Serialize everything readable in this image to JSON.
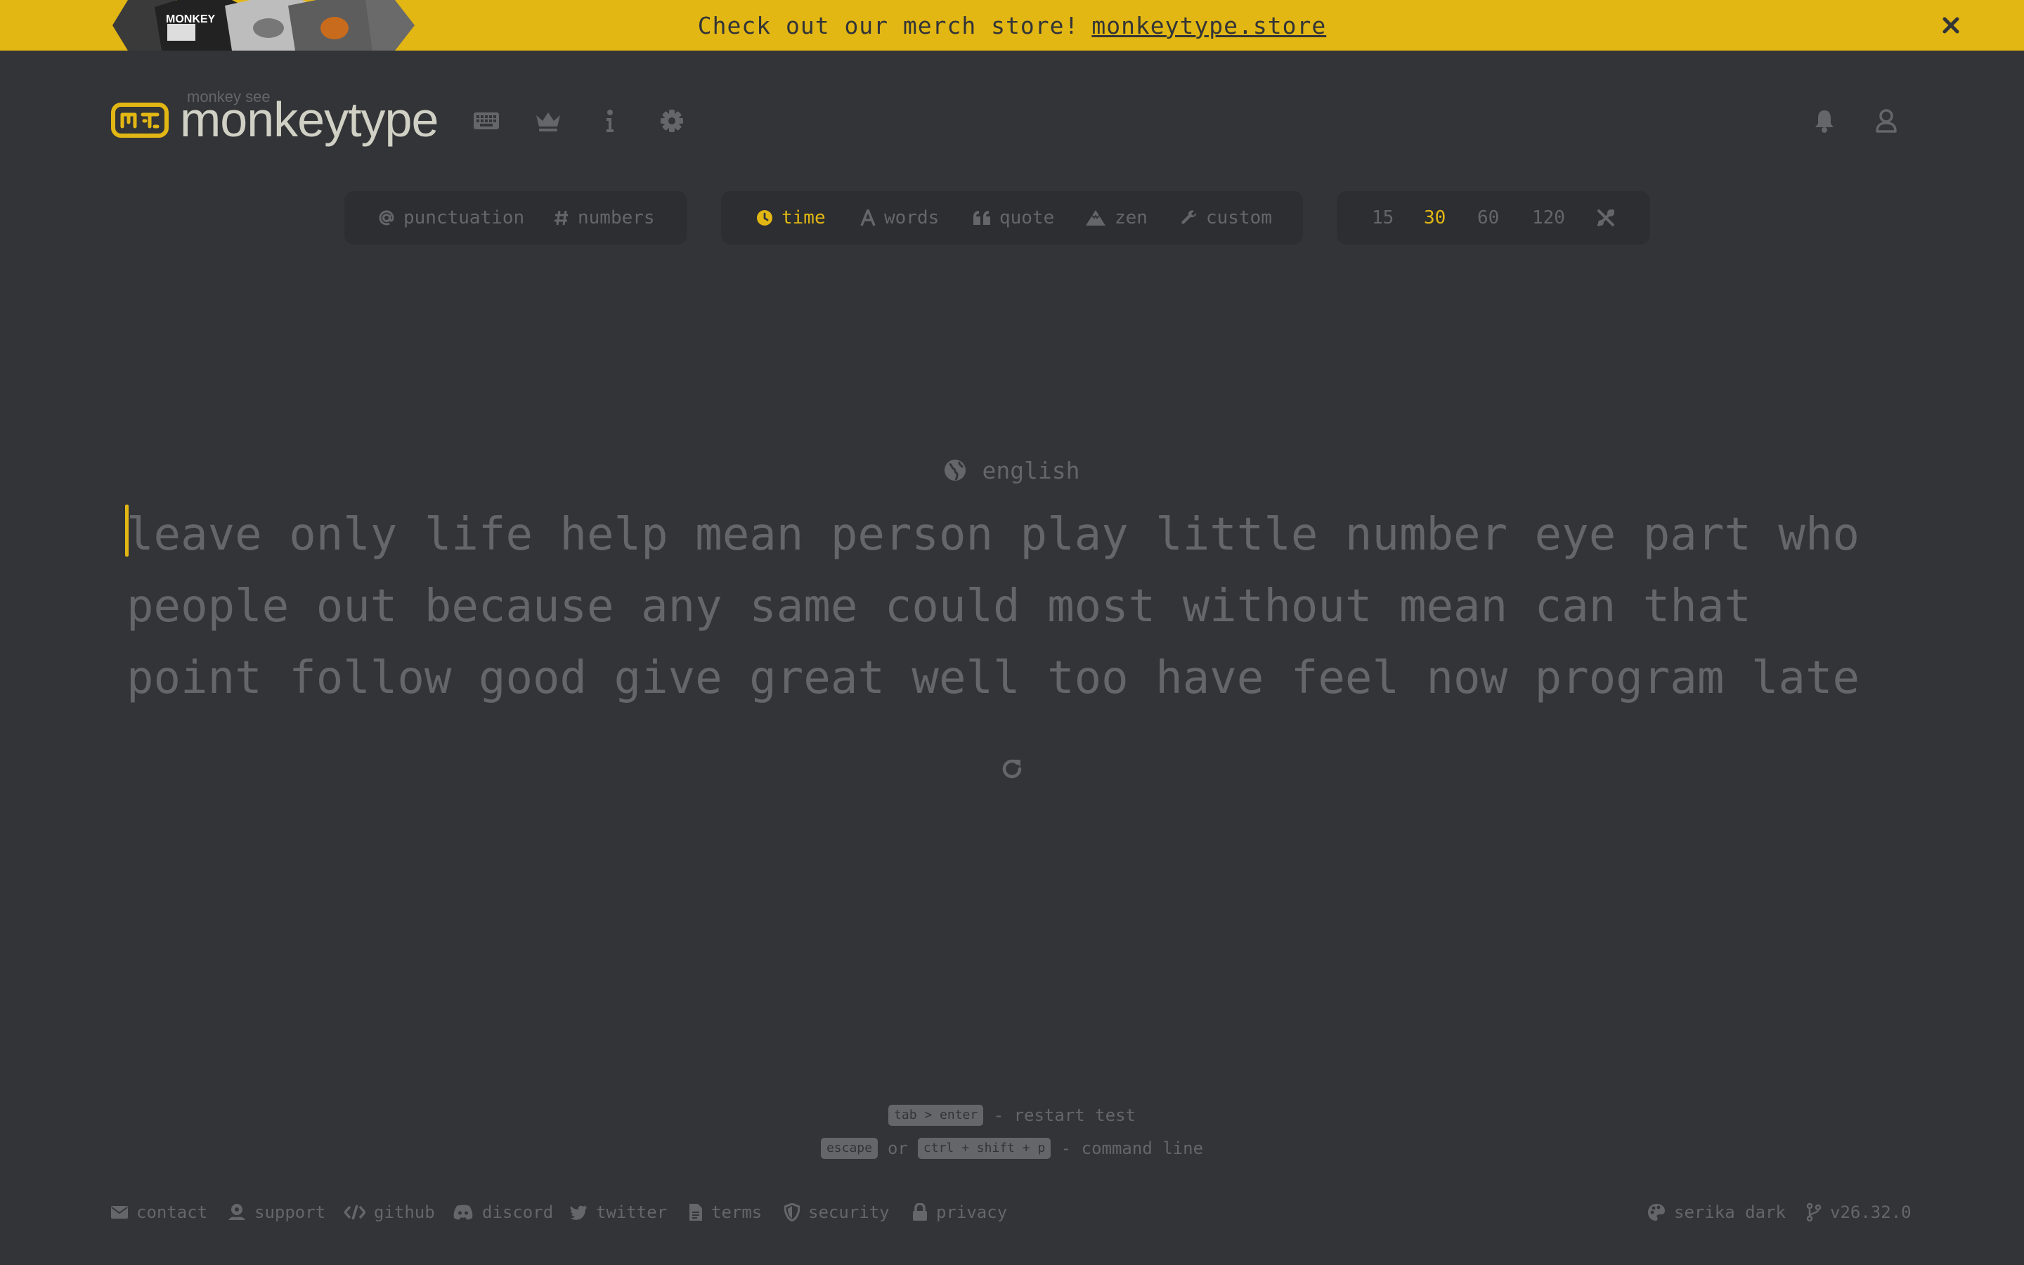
{
  "colors": {
    "background": "#323437",
    "sub_background": "#2c2e31",
    "main": "#e2b714",
    "sub": "#646669",
    "text": "#d1d0c5"
  },
  "banner": {
    "text": "Check out our merch store!",
    "link": "monkeytype.store",
    "close_icon": "close-icon",
    "image_text": "MONKEY"
  },
  "header": {
    "logo_sub": "monkey see",
    "logo_text": "monkeytype",
    "nav_icons": [
      "keyboard-icon",
      "crown-icon",
      "info-icon",
      "gear-icon"
    ],
    "right_icons": [
      "bell-icon",
      "user-icon"
    ]
  },
  "config": {
    "modifiers": [
      {
        "label": "punctuation",
        "icon": "at-icon"
      },
      {
        "label": "numbers",
        "icon": "hash-icon"
      }
    ],
    "modes": [
      {
        "label": "time",
        "icon": "clock-icon",
        "active": true
      },
      {
        "label": "words",
        "icon": "letter-a-icon",
        "active": false
      },
      {
        "label": "quote",
        "icon": "quote-icon",
        "active": false
      },
      {
        "label": "zen",
        "icon": "mountain-icon",
        "active": false
      },
      {
        "label": "custom",
        "icon": "wrench-icon",
        "active": false
      }
    ],
    "times": [
      {
        "label": "15",
        "active": false
      },
      {
        "label": "30",
        "active": true
      },
      {
        "label": "60",
        "active": false
      },
      {
        "label": "120",
        "active": false
      }
    ],
    "custom_time_icon": "tools-icon"
  },
  "test": {
    "language": "english",
    "lines": [
      "leave only life help mean person play little number eye part who",
      "people out because any same could most without mean can that",
      "point follow good give great well too have feel now program late"
    ],
    "restart_icon": "restart-icon"
  },
  "hints": {
    "restart_key": "tab > enter",
    "restart_text": "- restart test",
    "escape_key": "escape",
    "or_text": "or",
    "command_key": "ctrl + shift + p",
    "command_text": "- command line"
  },
  "footer": {
    "links": [
      {
        "label": "contact",
        "icon": "envelope-icon"
      },
      {
        "label": "support",
        "icon": "donate-icon"
      },
      {
        "label": "github",
        "icon": "code-icon"
      },
      {
        "label": "discord",
        "icon": "discord-icon"
      },
      {
        "label": "twitter",
        "icon": "twitter-icon"
      },
      {
        "label": "terms",
        "icon": "file-icon"
      },
      {
        "label": "security",
        "icon": "shield-icon"
      },
      {
        "label": "privacy",
        "icon": "lock-icon"
      }
    ],
    "theme": "serika dark",
    "theme_icon": "palette-icon",
    "version": "v26.32.0",
    "version_icon": "branch-icon"
  }
}
